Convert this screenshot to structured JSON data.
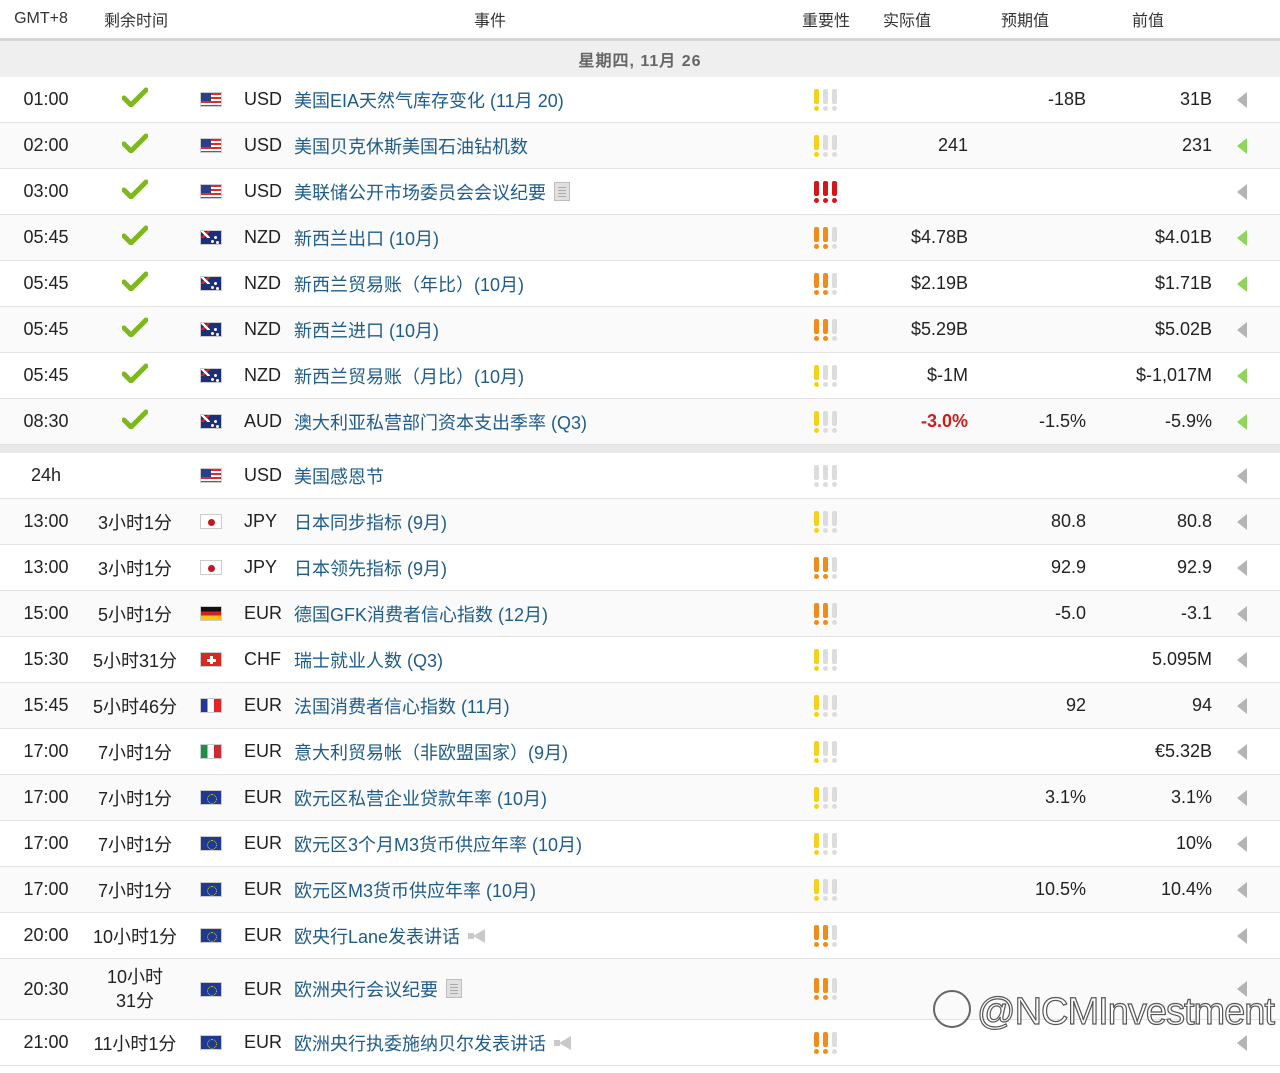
{
  "header": {
    "timezone": "GMT+8",
    "remaining": "剩余时间",
    "event": "事件",
    "importance": "重要性",
    "actual": "实际值",
    "forecast": "预期值",
    "previous": "前值"
  },
  "day_label": "星期四, 11月 26",
  "importance_colors": {
    "inactive": "#dcdcdc",
    "low": "#f2d21a",
    "medium": "#ef8c1d",
    "high": "#d4161b"
  },
  "rows": [
    {
      "time": "01:00",
      "remaining": "",
      "done": true,
      "flag": "us",
      "currency": "USD",
      "event": "美国EIA天然气库存变化 (11月 20)",
      "icon": "",
      "importance": 1,
      "actual": "",
      "actual_neg": false,
      "forecast": "-18B",
      "previous": "31B",
      "arrow": "gray"
    },
    {
      "time": "02:00",
      "remaining": "",
      "done": true,
      "flag": "us",
      "currency": "USD",
      "event": "美国贝克休斯美国石油钻机数",
      "icon": "",
      "importance": 1,
      "actual": "241",
      "actual_neg": false,
      "forecast": "",
      "previous": "231",
      "arrow": "green"
    },
    {
      "time": "03:00",
      "remaining": "",
      "done": true,
      "flag": "us",
      "currency": "USD",
      "event": "美联储公开市场委员会会议纪要",
      "icon": "document",
      "importance": 3,
      "actual": "",
      "actual_neg": false,
      "forecast": "",
      "previous": "",
      "arrow": "gray"
    },
    {
      "time": "05:45",
      "remaining": "",
      "done": true,
      "flag": "nz",
      "currency": "NZD",
      "event": "新西兰出口 (10月)",
      "icon": "",
      "importance": 2,
      "actual": "$4.78B",
      "actual_neg": false,
      "forecast": "",
      "previous": "$4.01B",
      "arrow": "green"
    },
    {
      "time": "05:45",
      "remaining": "",
      "done": true,
      "flag": "nz",
      "currency": "NZD",
      "event": "新西兰贸易账（年比）(10月)",
      "icon": "",
      "importance": 2,
      "actual": "$2.19B",
      "actual_neg": false,
      "forecast": "",
      "previous": "$1.71B",
      "arrow": "green"
    },
    {
      "time": "05:45",
      "remaining": "",
      "done": true,
      "flag": "nz",
      "currency": "NZD",
      "event": "新西兰进口 (10月)",
      "icon": "",
      "importance": 2,
      "actual": "$5.29B",
      "actual_neg": false,
      "forecast": "",
      "previous": "$5.02B",
      "arrow": "gray"
    },
    {
      "time": "05:45",
      "remaining": "",
      "done": true,
      "flag": "nz",
      "currency": "NZD",
      "event": "新西兰贸易账（月比）(10月)",
      "icon": "",
      "importance": 1,
      "actual": "$-1M",
      "actual_neg": false,
      "forecast": "",
      "previous": "$-1,017M",
      "arrow": "green"
    },
    {
      "time": "08:30",
      "remaining": "",
      "done": true,
      "flag": "au",
      "currency": "AUD",
      "event": "澳大利亚私营部门资本支出季率 (Q3)",
      "icon": "",
      "importance": 1,
      "actual": "-3.0%",
      "actual_neg": true,
      "forecast": "-1.5%",
      "previous": "-5.9%",
      "arrow": "green"
    }
  ],
  "rows2": [
    {
      "time": "24h",
      "remaining": "",
      "done": false,
      "flag": "us",
      "currency": "USD",
      "event": "美国感恩节",
      "icon": "",
      "importance": 0,
      "actual": "",
      "actual_neg": false,
      "forecast": "",
      "previous": "",
      "arrow": "gray"
    },
    {
      "time": "13:00",
      "remaining": "3小时1分",
      "done": false,
      "flag": "jp",
      "currency": "JPY",
      "event": "日本同步指标 (9月)",
      "icon": "",
      "importance": 1,
      "actual": "",
      "actual_neg": false,
      "forecast": "80.8",
      "previous": "80.8",
      "arrow": "gray"
    },
    {
      "time": "13:00",
      "remaining": "3小时1分",
      "done": false,
      "flag": "jp",
      "currency": "JPY",
      "event": "日本领先指标 (9月)",
      "icon": "",
      "importance": 2,
      "actual": "",
      "actual_neg": false,
      "forecast": "92.9",
      "previous": "92.9",
      "arrow": "gray"
    },
    {
      "time": "15:00",
      "remaining": "5小时1分",
      "done": false,
      "flag": "de",
      "currency": "EUR",
      "event": "德国GFK消费者信心指数 (12月)",
      "icon": "",
      "importance": 2,
      "actual": "",
      "actual_neg": false,
      "forecast": "-5.0",
      "previous": "-3.1",
      "arrow": "gray"
    },
    {
      "time": "15:30",
      "remaining": "5小时31分",
      "done": false,
      "flag": "ch",
      "currency": "CHF",
      "event": "瑞士就业人数 (Q3)",
      "icon": "",
      "importance": 1,
      "actual": "",
      "actual_neg": false,
      "forecast": "",
      "previous": "5.095M",
      "arrow": "gray"
    },
    {
      "time": "15:45",
      "remaining": "5小时46分",
      "done": false,
      "flag": "fr",
      "currency": "EUR",
      "event": "法国消费者信心指数 (11月)",
      "icon": "",
      "importance": 1,
      "actual": "",
      "actual_neg": false,
      "forecast": "92",
      "previous": "94",
      "arrow": "gray"
    },
    {
      "time": "17:00",
      "remaining": "7小时1分",
      "done": false,
      "flag": "it",
      "currency": "EUR",
      "event": "意大利贸易帐（非欧盟国家）(9月)",
      "icon": "",
      "importance": 1,
      "actual": "",
      "actual_neg": false,
      "forecast": "",
      "previous": "€5.32B",
      "arrow": "gray"
    },
    {
      "time": "17:00",
      "remaining": "7小时1分",
      "done": false,
      "flag": "eu",
      "currency": "EUR",
      "event": "欧元区私营企业贷款年率 (10月)",
      "icon": "",
      "importance": 1,
      "actual": "",
      "actual_neg": false,
      "forecast": "3.1%",
      "previous": "3.1%",
      "arrow": "gray"
    },
    {
      "time": "17:00",
      "remaining": "7小时1分",
      "done": false,
      "flag": "eu",
      "currency": "EUR",
      "event": "欧元区3个月M3货币供应年率 (10月)",
      "icon": "",
      "importance": 1,
      "actual": "",
      "actual_neg": false,
      "forecast": "",
      "previous": "10%",
      "arrow": "gray"
    },
    {
      "time": "17:00",
      "remaining": "7小时1分",
      "done": false,
      "flag": "eu",
      "currency": "EUR",
      "event": "欧元区M3货币供应年率 (10月)",
      "icon": "",
      "importance": 1,
      "actual": "",
      "actual_neg": false,
      "forecast": "10.5%",
      "previous": "10.4%",
      "arrow": "gray"
    },
    {
      "time": "20:00",
      "remaining": "10小时1分",
      "done": false,
      "flag": "eu",
      "currency": "EUR",
      "event": "欧央行Lane发表讲话",
      "icon": "speech",
      "importance": 2,
      "actual": "",
      "actual_neg": false,
      "forecast": "",
      "previous": "",
      "arrow": "gray"
    },
    {
      "time": "20:30",
      "remaining": "10小时31分",
      "done": false,
      "flag": "eu",
      "currency": "EUR",
      "event": "欧洲央行会议纪要",
      "icon": "document",
      "importance": 2,
      "actual": "",
      "actual_neg": false,
      "forecast": "",
      "previous": "",
      "arrow": "gray",
      "tall": true
    },
    {
      "time": "21:00",
      "remaining": "11小时1分",
      "done": false,
      "flag": "eu",
      "currency": "EUR",
      "event": "欧洲央行执委施纳贝尔发表讲话",
      "icon": "speech",
      "importance": 2,
      "actual": "",
      "actual_neg": false,
      "forecast": "",
      "previous": "",
      "arrow": "gray"
    }
  ],
  "watermark": "@NCMInvestment"
}
